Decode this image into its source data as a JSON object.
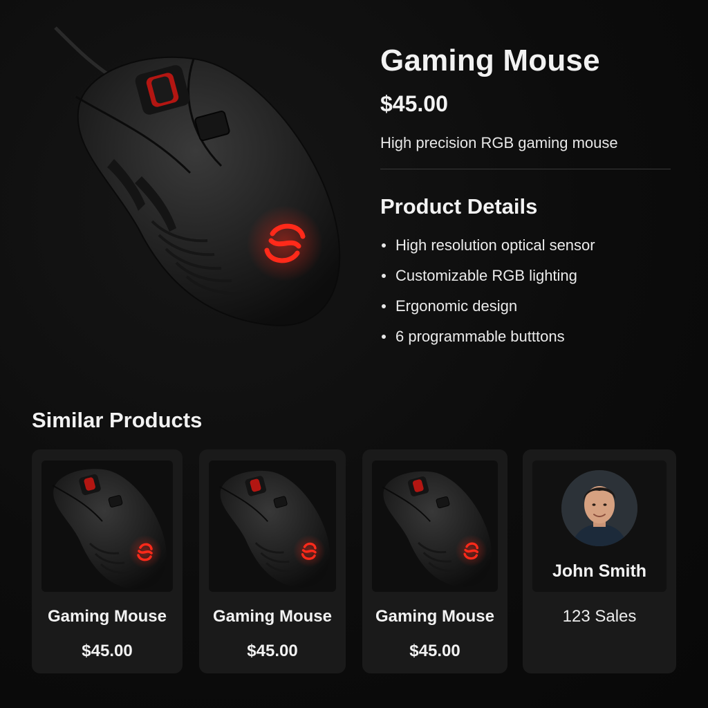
{
  "product": {
    "title": "Gaming Mouse",
    "price": "$45.00",
    "description": "High precision RGB gaming mouse"
  },
  "details": {
    "heading": "Product Details",
    "items": [
      "High resolution optical sensor",
      "Customizable RGB lighting",
      "Ergonomic design",
      "6 programmable butttons"
    ]
  },
  "similar": {
    "heading": "Similar Products",
    "products": [
      {
        "name": "Gaming Mouse",
        "price": "$45.00"
      },
      {
        "name": "Gaming Mouse",
        "price": "$45.00"
      },
      {
        "name": "Gaming Mouse",
        "price": "$45.00"
      }
    ],
    "seller": {
      "name": "John Smith",
      "sales": "123 Sales"
    }
  },
  "colors": {
    "background": "#0c0c0c",
    "card": "#1a1a1a",
    "accent_red": "#e0201c",
    "text": "#f2f2f2"
  },
  "icons": {
    "logo": "s-swirl-logo-icon",
    "bullet": "bullet-dot-icon"
  }
}
